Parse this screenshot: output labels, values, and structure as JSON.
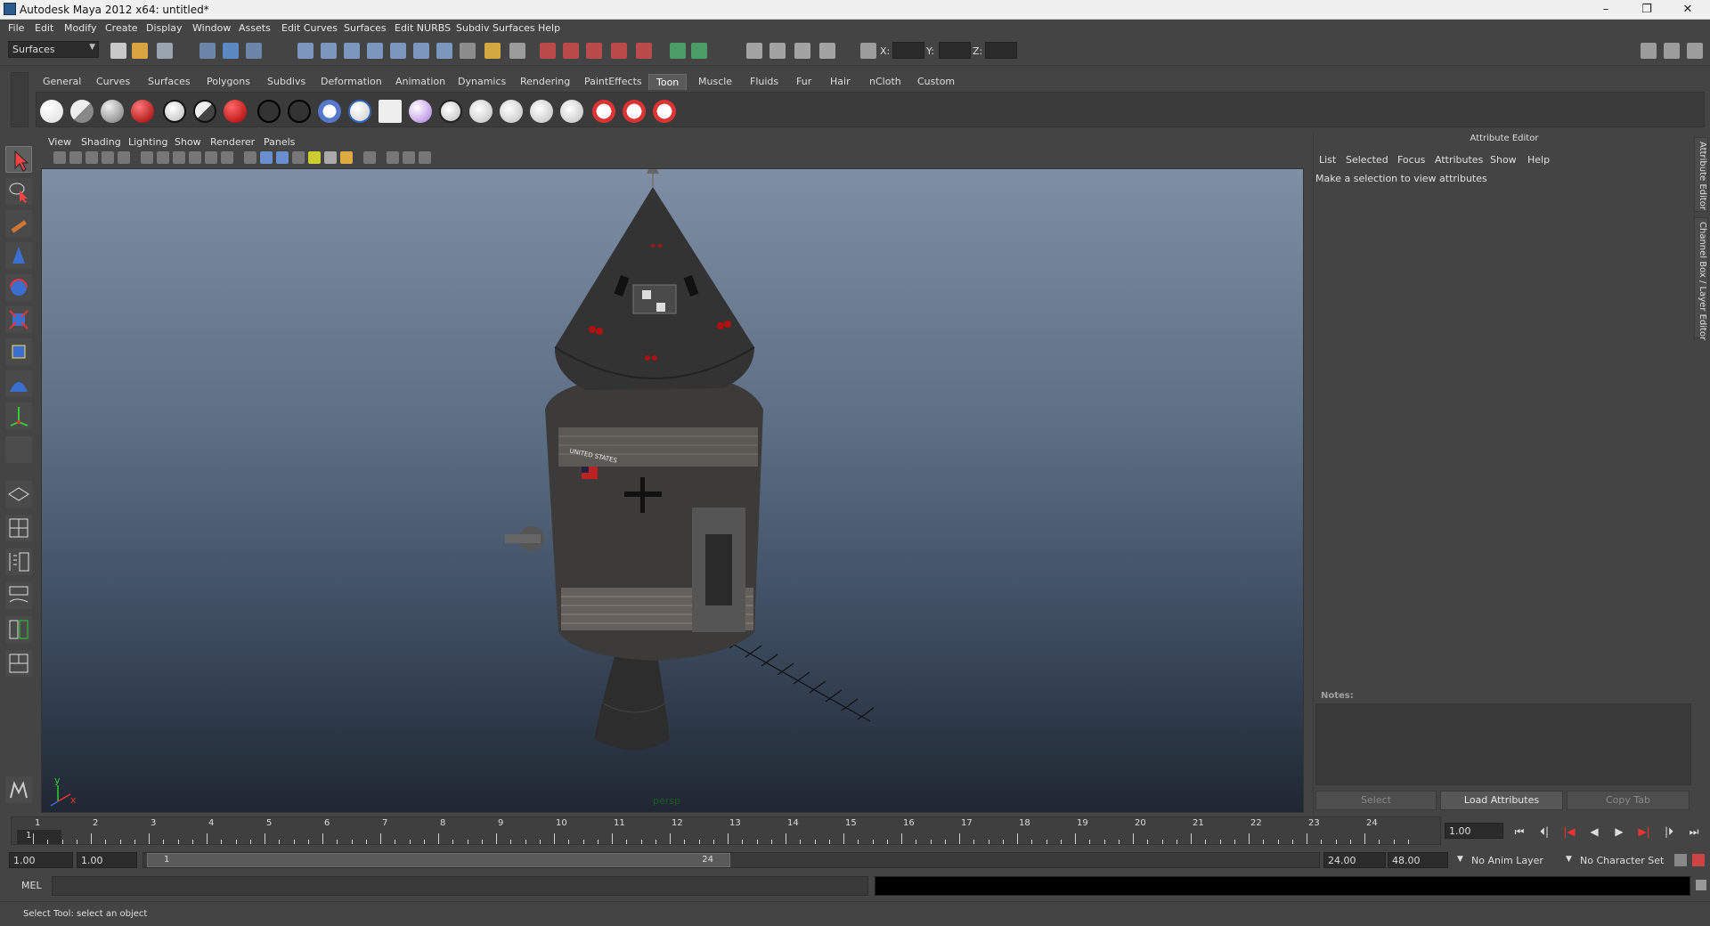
{
  "window": {
    "title": "Autodesk Maya 2012 x64: untitled*",
    "controls": {
      "minimize": "–",
      "maximize": "❐",
      "close": "✕"
    }
  },
  "menubar": {
    "items": [
      "File",
      "Edit",
      "Modify",
      "Create",
      "Display",
      "Window",
      "Assets",
      "Edit Curves",
      "Surfaces",
      "Edit NURBS",
      "Subdiv Surfaces",
      "Help"
    ]
  },
  "statusline": {
    "menu_set": "Surfaces",
    "x_label": "X:",
    "y_label": "Y:",
    "z_label": "Z:"
  },
  "shelf": {
    "tabs": [
      "General",
      "Curves",
      "Surfaces",
      "Polygons",
      "Subdivs",
      "Deformation",
      "Animation",
      "Dynamics",
      "Rendering",
      "PaintEffects",
      "Toon",
      "Muscle",
      "Fluids",
      "Fur",
      "Hair",
      "nCloth",
      "Custom"
    ],
    "active_tab": "Toon"
  },
  "viewport": {
    "menus": [
      "View",
      "Shading",
      "Lighting",
      "Show",
      "Renderer",
      "Panels"
    ],
    "camera_label": "persp",
    "axis_y": "y",
    "axis_x": "x",
    "decal_text": "UNITED STATES"
  },
  "attribute_editor": {
    "title": "Attribute Editor",
    "menus": [
      "List",
      "Selected",
      "Focus",
      "Attributes",
      "Show",
      "Help"
    ],
    "message": "Make a selection to view attributes",
    "notes_label": "Notes:",
    "buttons": {
      "select": "Select",
      "load": "Load Attributes",
      "copy": "Copy Tab"
    },
    "side_tabs": [
      "Attribute Editor",
      "Channel Box / Layer Editor"
    ]
  },
  "timeslider": {
    "ticks": [
      "1",
      "2",
      "3",
      "4",
      "5",
      "6",
      "7",
      "8",
      "9",
      "10",
      "11",
      "12",
      "13",
      "14",
      "15",
      "16",
      "17",
      "18",
      "19",
      "20",
      "21",
      "22",
      "23",
      "24"
    ],
    "current_frame_marker": "1",
    "current_frame": "1.00"
  },
  "playback_controls": [
    "⏮",
    "⏴|",
    "|◀",
    "◀",
    "▶",
    "▶|",
    "|⏵",
    "⏭"
  ],
  "range_slider": {
    "start_time": "1.00",
    "playback_start": "1.00",
    "range_start_label": "1",
    "range_end_label": "24",
    "playback_end": "24.00",
    "end_time": "48.00",
    "anim_layer": "No Anim Layer",
    "character_set": "No Character Set"
  },
  "command_line": {
    "label": "MEL"
  },
  "help_line": {
    "text": "Select Tool: select an object"
  },
  "colors": {
    "ui_bg": "#444444",
    "viewport_top": "#7e8ea4",
    "viewport_bottom": "#1f2732",
    "active_tab": "#5a5a5a"
  }
}
